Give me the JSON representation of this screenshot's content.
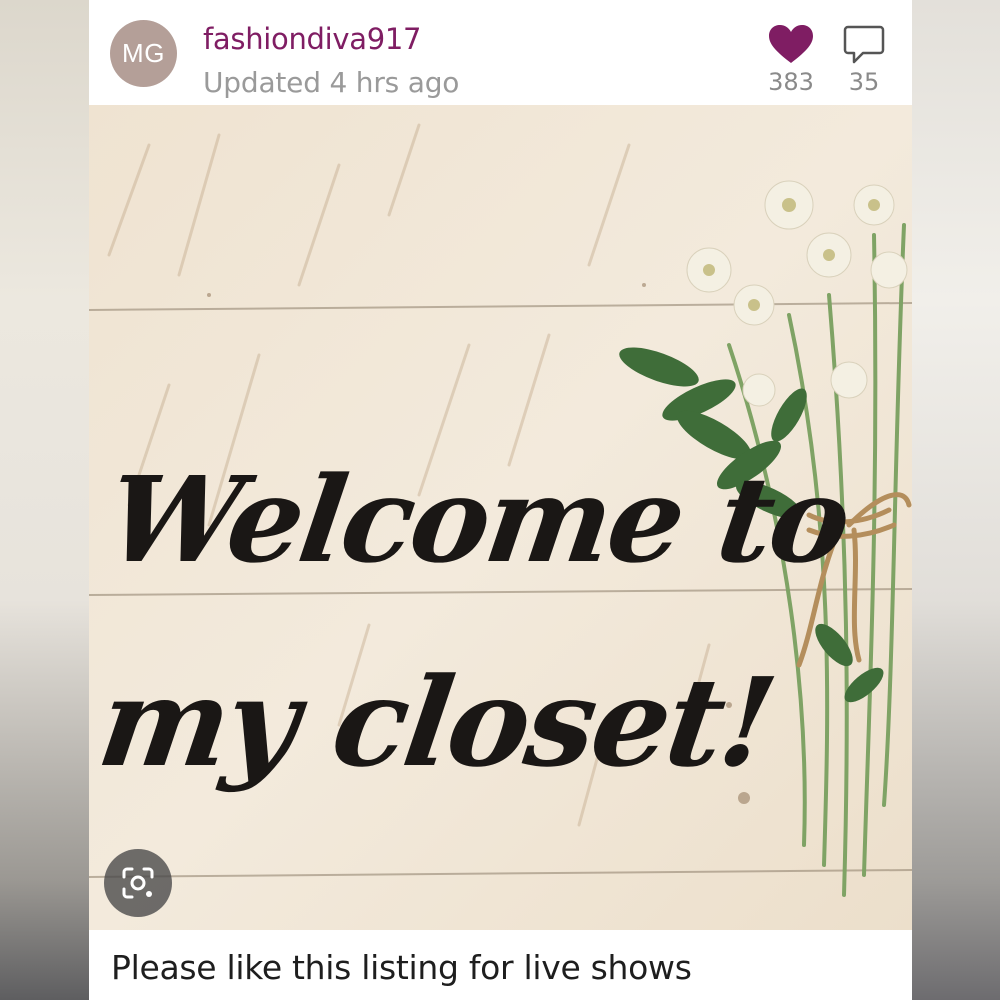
{
  "post": {
    "avatar_initials": "MG",
    "username": "fashiondiva917",
    "updated": "Updated 4 hrs ago",
    "likes": "383",
    "comments": "35"
  },
  "listing": {
    "headline_line1": "Welcome to",
    "headline_line2": "my closet!",
    "caption": "Please like this listing for live shows"
  },
  "icons": {
    "like": "heart-icon",
    "comment": "speech-bubble-icon",
    "lens": "visual-search-icon"
  },
  "colors": {
    "brand": "#7f1d63",
    "avatar_bg": "#b49f98",
    "secondary_text": "#9a9a9a",
    "wood": "#efe5d5"
  }
}
